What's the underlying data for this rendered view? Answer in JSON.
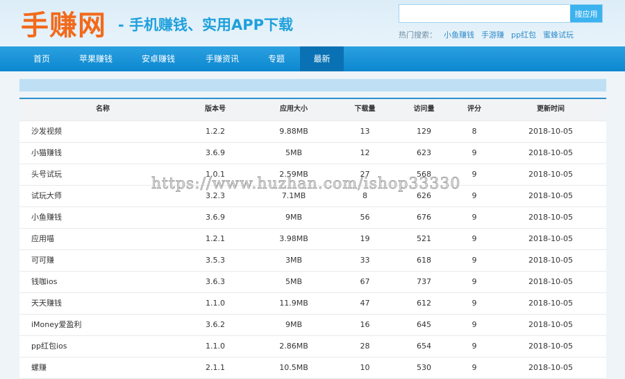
{
  "header": {
    "logo": "手赚网",
    "slogan": "- 手机赚钱、实用APP下载",
    "search_placeholder": "",
    "search_button": "搜应用",
    "hot_label": "热门搜索：",
    "hot_links": [
      "小鱼赚钱",
      "手游赚",
      "pp红包",
      "蜜蜂试玩"
    ]
  },
  "nav": [
    "首页",
    "苹果赚钱",
    "安卓赚钱",
    "手赚资讯",
    "专题",
    "最新"
  ],
  "table": {
    "columns": [
      "名称",
      "版本号",
      "应用大小",
      "下载量",
      "访问量",
      "评分",
      "更新时间"
    ],
    "rows": [
      [
        "沙发视频",
        "1.2.2",
        "9.88MB",
        "13",
        "129",
        "8",
        "2018-10-05"
      ],
      [
        "小猫赚钱",
        "3.6.9",
        "5MB",
        "12",
        "623",
        "9",
        "2018-10-05"
      ],
      [
        "头号试玩",
        "1.0.1",
        "2.59MB",
        "27",
        "568",
        "9",
        "2018-10-05"
      ],
      [
        "试玩大师",
        "3.2.3",
        "7.1MB",
        "8",
        "626",
        "9",
        "2018-10-05"
      ],
      [
        "小鱼赚钱",
        "3.6.9",
        "9MB",
        "56",
        "676",
        "9",
        "2018-10-05"
      ],
      [
        "应用喵",
        "1.2.1",
        "3.98MB",
        "19",
        "521",
        "9",
        "2018-10-05"
      ],
      [
        "可可赚",
        "3.5.3",
        "3MB",
        "33",
        "618",
        "9",
        "2018-10-05"
      ],
      [
        "钱咖ios",
        "3.6.3",
        "5MB",
        "67",
        "737",
        "9",
        "2018-10-05"
      ],
      [
        "天天赚钱",
        "1.1.0",
        "11.9MB",
        "47",
        "612",
        "9",
        "2018-10-05"
      ],
      [
        "iMoney爱盈利",
        "3.6.2",
        "9MB",
        "16",
        "645",
        "9",
        "2018-10-05"
      ],
      [
        "pp红包ios",
        "1.1.0",
        "2.86MB",
        "28",
        "654",
        "9",
        "2018-10-05"
      ],
      [
        "螺赚",
        "2.1.1",
        "10.5MB",
        "10",
        "530",
        "9",
        "2018-10-05"
      ]
    ]
  },
  "watermark": "https://www.huzhan.com/ishop33330"
}
